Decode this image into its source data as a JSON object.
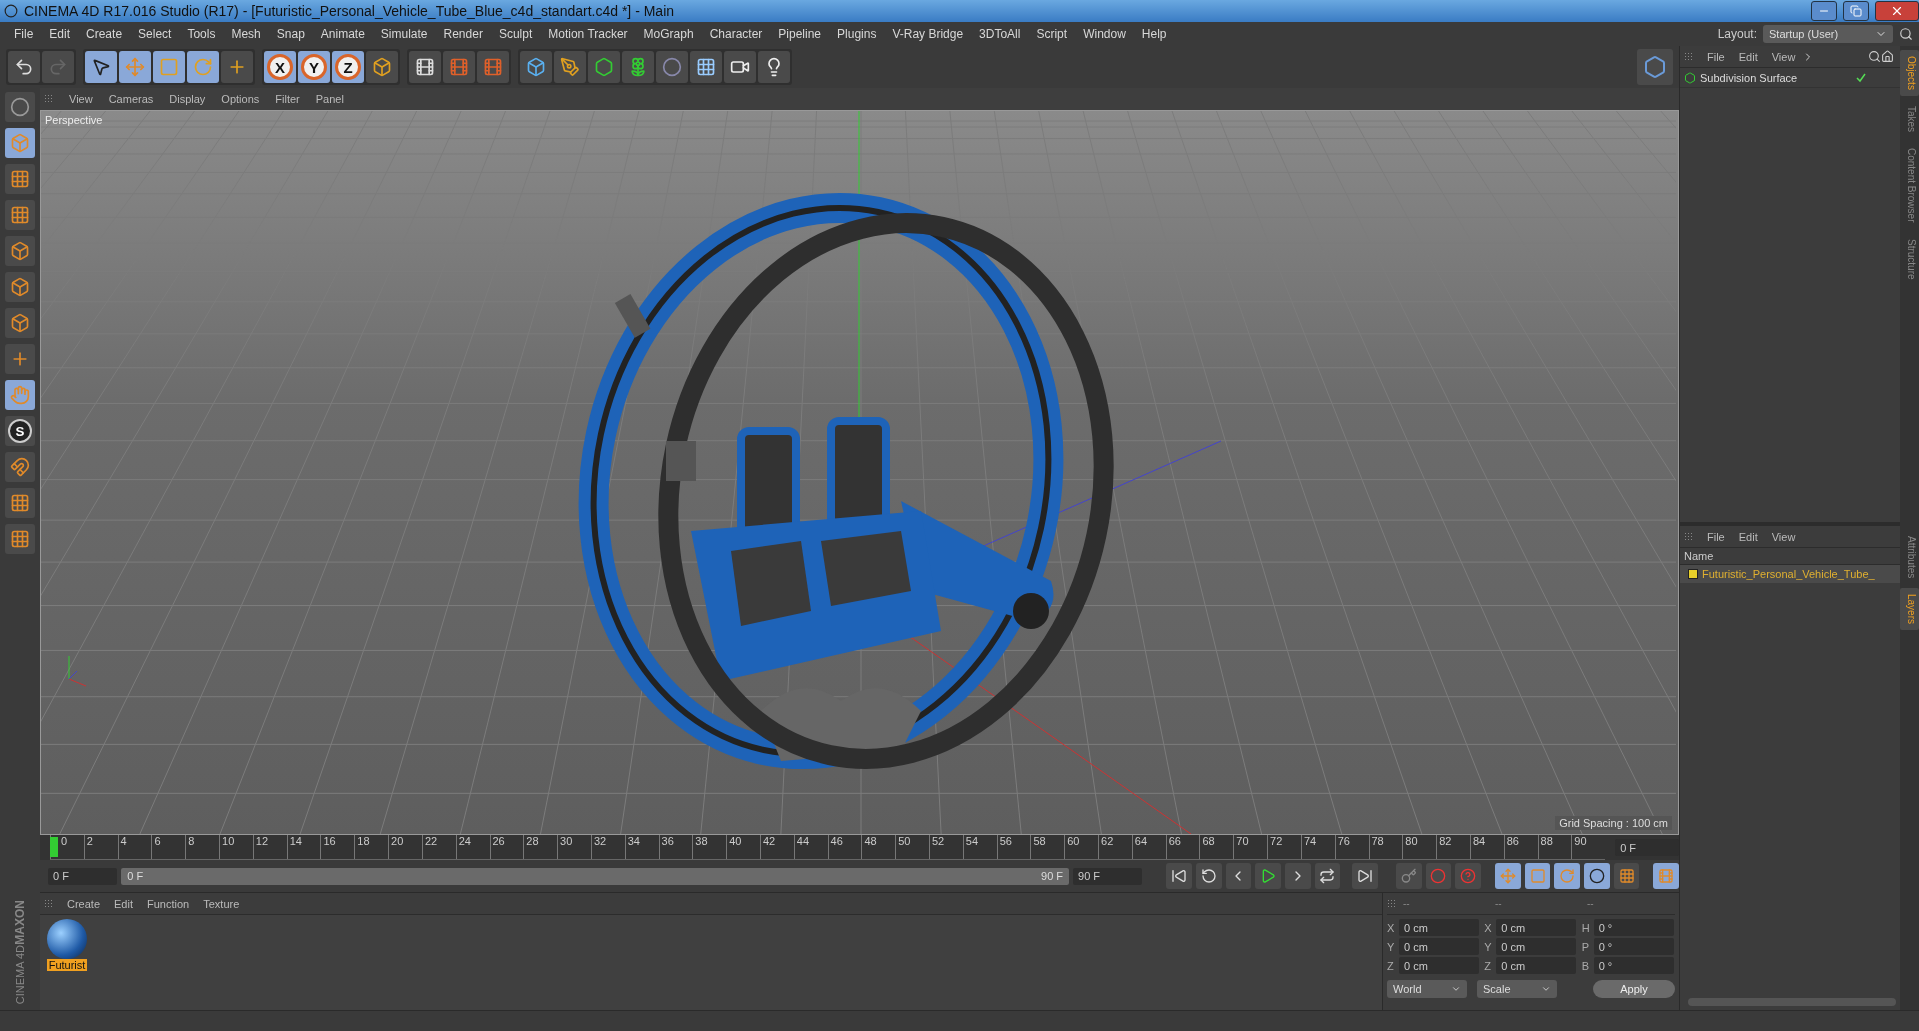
{
  "window": {
    "title": "CINEMA 4D R17.016 Studio (R17) - [Futuristic_Personal_Vehicle_Tube_Blue_c4d_standart.c4d *] - Main"
  },
  "menu": [
    "File",
    "Edit",
    "Create",
    "Select",
    "Tools",
    "Mesh",
    "Snap",
    "Animate",
    "Simulate",
    "Render",
    "Sculpt",
    "Motion Tracker",
    "MoGraph",
    "Character",
    "Pipeline",
    "Plugins",
    "V-Ray Bridge",
    "3DToAll",
    "Script",
    "Window",
    "Help"
  ],
  "layout": {
    "label": "Layout:",
    "value": "Startup (User)"
  },
  "axis_locks": [
    {
      "label": "X",
      "on": true
    },
    {
      "label": "Y",
      "on": true
    },
    {
      "label": "Z",
      "on": true
    }
  ],
  "snap_letter": "S",
  "viewport": {
    "menu": [
      "View",
      "Cameras",
      "Display",
      "Options",
      "Filter",
      "Panel"
    ],
    "camera": "Perspective",
    "grid_spacing": "Grid Spacing : 100 cm"
  },
  "objects_panel": {
    "menu": [
      "File",
      "Edit",
      "View"
    ],
    "objects": [
      {
        "name": "Subdivision Surface",
        "enabled": true
      }
    ]
  },
  "side_tabs_top": [
    {
      "label": "Objects",
      "selected": true
    },
    {
      "label": "Takes",
      "selected": false
    },
    {
      "label": "Content Browser",
      "selected": false
    },
    {
      "label": "Structure",
      "selected": false
    }
  ],
  "layers_panel": {
    "menu": [
      "File",
      "Edit",
      "View"
    ],
    "column": "Name",
    "layers": [
      {
        "name": "Futuristic_Personal_Vehicle_Tube_",
        "color": "#e8d02a"
      }
    ]
  },
  "side_tabs_bottom": [
    {
      "label": "Attributes",
      "selected": false
    },
    {
      "label": "Layers",
      "selected": true
    }
  ],
  "timeline": {
    "ticks": [
      "0",
      "2",
      "4",
      "6",
      "8",
      "10",
      "12",
      "14",
      "16",
      "18",
      "20",
      "22",
      "24",
      "26",
      "28",
      "30",
      "32",
      "34",
      "36",
      "38",
      "40",
      "42",
      "44",
      "46",
      "48",
      "50",
      "52",
      "54",
      "56",
      "58",
      "60",
      "62",
      "64",
      "66",
      "68",
      "70",
      "72",
      "74",
      "76",
      "78",
      "80",
      "82",
      "84",
      "86",
      "88",
      "90"
    ],
    "level": 0,
    "current_frame": "0 F"
  },
  "transport": {
    "level": 1,
    "start": "0 F",
    "slider_start": "0 F",
    "slider_end": "90 F",
    "end": "90 F"
  },
  "materials": {
    "menu": [
      "Create",
      "Edit",
      "Function",
      "Texture"
    ],
    "items": [
      {
        "name": "Futurist",
        "selected": true
      }
    ]
  },
  "coordinates": {
    "headers": [
      "--",
      "--",
      "--"
    ],
    "columns": [
      [
        {
          "axis": "X",
          "value": "0 cm"
        },
        {
          "axis": "Y",
          "value": "0 cm"
        },
        {
          "axis": "Z",
          "value": "0 cm"
        }
      ],
      [
        {
          "axis": "X",
          "value": "0 cm"
        },
        {
          "axis": "Y",
          "value": "0 cm"
        },
        {
          "axis": "Z",
          "value": "0 cm"
        }
      ],
      [
        {
          "axis": "H",
          "value": "0 °"
        },
        {
          "axis": "P",
          "value": "0 °"
        },
        {
          "axis": "B",
          "value": "0 °"
        }
      ]
    ],
    "dropdowns": [
      "World",
      "Scale"
    ],
    "apply": "Apply"
  },
  "brand": {
    "top": "MAXON",
    "bottom": "CINEMA 4D"
  }
}
